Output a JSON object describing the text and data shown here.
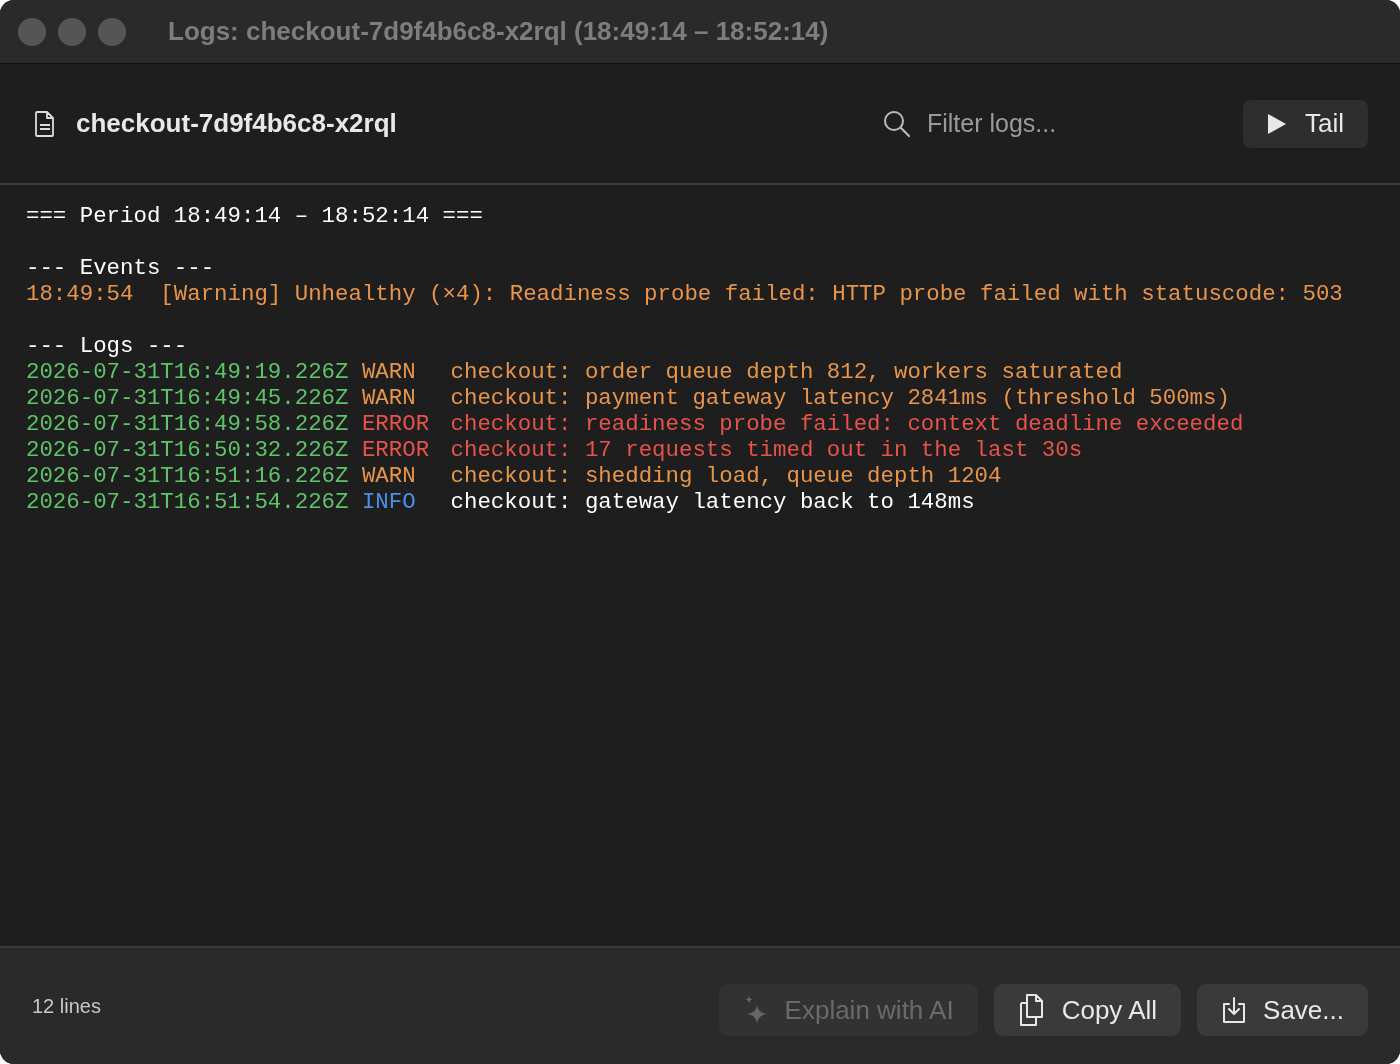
{
  "window": {
    "title": "Logs: checkout-7d9f4b6c8-x2rql (18:49:14 – 18:52:14)"
  },
  "toolbar": {
    "file_name": "checkout-7d9f4b6c8-x2rql",
    "search": {
      "placeholder": "Filter logs..."
    },
    "tail_button": {
      "label": "Tail"
    }
  },
  "log_lines": [
    {
      "kind": "header",
      "text": "=== Period 18:49:14 – 18:52:14 ==="
    },
    {
      "kind": "blank"
    },
    {
      "kind": "header",
      "text": "--- Events ---"
    },
    {
      "kind": "event",
      "text": "18:49:54  [Warning] Unhealthy (×4): Readiness probe failed: HTTP probe failed with statuscode: 503"
    },
    {
      "kind": "blank"
    },
    {
      "kind": "header",
      "text": "--- Logs ---"
    },
    {
      "kind": "log",
      "timestamp": "2026-07-31T16:49:19.226Z",
      "level": {
        "text": "WARN",
        "color": "#e8954a"
      },
      "message": {
        "text": "checkout: order queue depth 812, workers saturated",
        "color": "#e8954a"
      }
    },
    {
      "kind": "log",
      "timestamp": "2026-07-31T16:49:45.226Z",
      "level": {
        "text": "WARN",
        "color": "#e8954a"
      },
      "message": {
        "text": "checkout: payment gateway latency 2841ms (threshold 500ms)",
        "color": "#e8954a"
      }
    },
    {
      "kind": "log",
      "timestamp": "2026-07-31T16:49:58.226Z",
      "level": {
        "text": "ERROR",
        "color": "#e5534b"
      },
      "message": {
        "text": "checkout: readiness probe failed: context deadline exceeded",
        "color": "#e5534b"
      }
    },
    {
      "kind": "log",
      "timestamp": "2026-07-31T16:50:32.226Z",
      "level": {
        "text": "ERROR",
        "color": "#e5534b"
      },
      "message": {
        "text": "checkout: 17 requests timed out in the last 30s",
        "color": "#e5534b"
      }
    },
    {
      "kind": "log",
      "timestamp": "2026-07-31T16:51:16.226Z",
      "level": {
        "text": "WARN",
        "color": "#e8954a"
      },
      "message": {
        "text": "checkout: shedding load, queue depth 1204",
        "color": "#e8954a"
      }
    },
    {
      "kind": "log",
      "timestamp": "2026-07-31T16:51:54.226Z",
      "level": {
        "text": "INFO",
        "color": "#4a8fe8"
      },
      "message": {
        "text": "checkout: gateway latency back to 148ms",
        "color": "#ffffff"
      }
    }
  ],
  "footer": {
    "line_count": "12 lines",
    "buttons": [
      {
        "kind": "ai",
        "label": "Explain with AI",
        "disabled": true
      },
      {
        "kind": "copy",
        "label": "Copy All",
        "disabled": false
      },
      {
        "kind": "save",
        "label": "Save...",
        "disabled": false
      }
    ]
  }
}
